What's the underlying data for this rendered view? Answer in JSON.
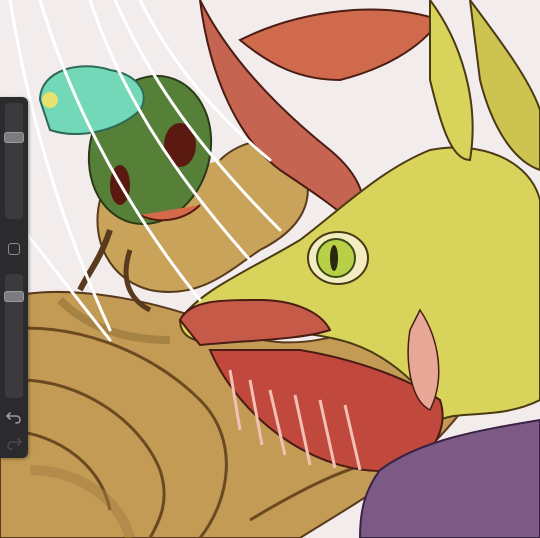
{
  "app": {
    "view": "drawing-canvas",
    "artwork_subject": "illustration"
  },
  "sidebar": {
    "brush_size_level": 0.72,
    "opacity_level": 0.15,
    "modify_button_icon": "square-outline-icon",
    "undo_icon": "undo-arrow-icon",
    "redo_icon": "redo-arrow-icon"
  },
  "colors": {
    "background": "#f2ecec",
    "sidebar": "#2b2b2d",
    "creature_yellow": "#d8d35a",
    "horn_red": "#c8583f",
    "body_tan": "#c9a35a",
    "goblin_green": "#4f7a34",
    "teal": "#6fd4b4",
    "purple": "#7d5a86"
  }
}
